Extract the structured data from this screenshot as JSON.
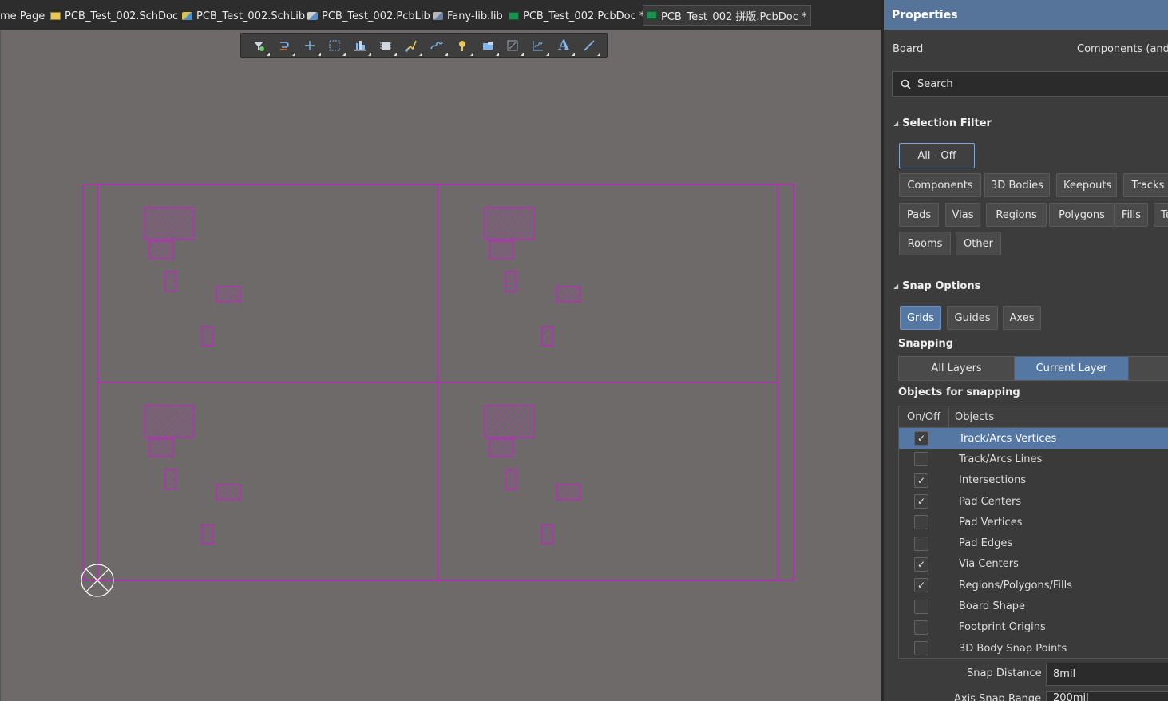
{
  "tabs": [
    {
      "label": "me Page",
      "icon": "home-page-icon"
    },
    {
      "label": "PCB_Test_002.SchDoc",
      "icon": "schdoc-icon"
    },
    {
      "label": "PCB_Test_002.SchLib",
      "icon": "schlib-icon"
    },
    {
      "label": "PCB_Test_002.PcbLib",
      "icon": "pcblib-icon"
    },
    {
      "label": "Fany-lib.lib",
      "icon": "lib-icon"
    },
    {
      "label": "PCB_Test_002.PcbDoc *",
      "icon": "pcbdoc-icon"
    },
    {
      "label": "PCB_Test_002 拼版.PcbDoc *",
      "icon": "pcbdoc-icon"
    }
  ],
  "toolbar": {
    "tools": [
      "filter-icon",
      "interactive-route-icon",
      "place-cross-icon",
      "select-rect-icon",
      "align-icon",
      "component-icon",
      "route-multiple-icon",
      "diff-pair-icon",
      "pad-icon",
      "fill-icon",
      "dimension-icon",
      "wave-icon",
      "text-icon",
      "line-icon"
    ],
    "text_tool_glyph": "A"
  },
  "pcb": {
    "board_color": "#c026c4",
    "canvas_color": "#6e6a69"
  },
  "panel": {
    "title": "Properties",
    "board_label": "Board",
    "components_label": "Components (and",
    "search_placeholder": "Search",
    "selection_filter": {
      "title": "Selection Filter",
      "all_off": "All - Off",
      "row1": [
        "Components",
        "3D Bodies",
        "Keepouts",
        "Tracks"
      ],
      "row2": [
        "Pads",
        "Vias",
        "Regions",
        "Polygons",
        "Fills",
        "Te"
      ],
      "row3": [
        "Rooms",
        "Other"
      ]
    },
    "snap_options": {
      "title": "Snap Options",
      "modes": [
        {
          "label": "Grids",
          "on": true
        },
        {
          "label": "Guides",
          "on": false
        },
        {
          "label": "Axes",
          "on": false
        }
      ],
      "snapping_label": "Snapping",
      "snapping_modes": [
        {
          "label": "All Layers",
          "on": false
        },
        {
          "label": "Current Layer",
          "on": true
        },
        {
          "label": "",
          "on": false
        }
      ],
      "objects_label": "Objects for snapping",
      "table_headers": [
        "On/Off",
        "Objects"
      ],
      "objects": [
        {
          "name": "Track/Arcs Vertices",
          "checked": true,
          "selected": true
        },
        {
          "name": "Track/Arcs Lines",
          "checked": false,
          "selected": false
        },
        {
          "name": "Intersections",
          "checked": true,
          "selected": false
        },
        {
          "name": "Pad Centers",
          "checked": true,
          "selected": false
        },
        {
          "name": "Pad Vertices",
          "checked": false,
          "selected": false
        },
        {
          "name": "Pad Edges",
          "checked": false,
          "selected": false
        },
        {
          "name": "Via Centers",
          "checked": true,
          "selected": false
        },
        {
          "name": "Regions/Polygons/Fills",
          "checked": true,
          "selected": false
        },
        {
          "name": "Board Shape",
          "checked": false,
          "selected": false
        },
        {
          "name": "Footprint Origins",
          "checked": false,
          "selected": false
        },
        {
          "name": "3D Body Snap Points",
          "checked": false,
          "selected": false
        }
      ],
      "snap_distance_label": "Snap Distance",
      "snap_distance_value": "8mil",
      "axis_snap_label": "Axis Snap Range",
      "axis_snap_value": "200mil"
    }
  }
}
